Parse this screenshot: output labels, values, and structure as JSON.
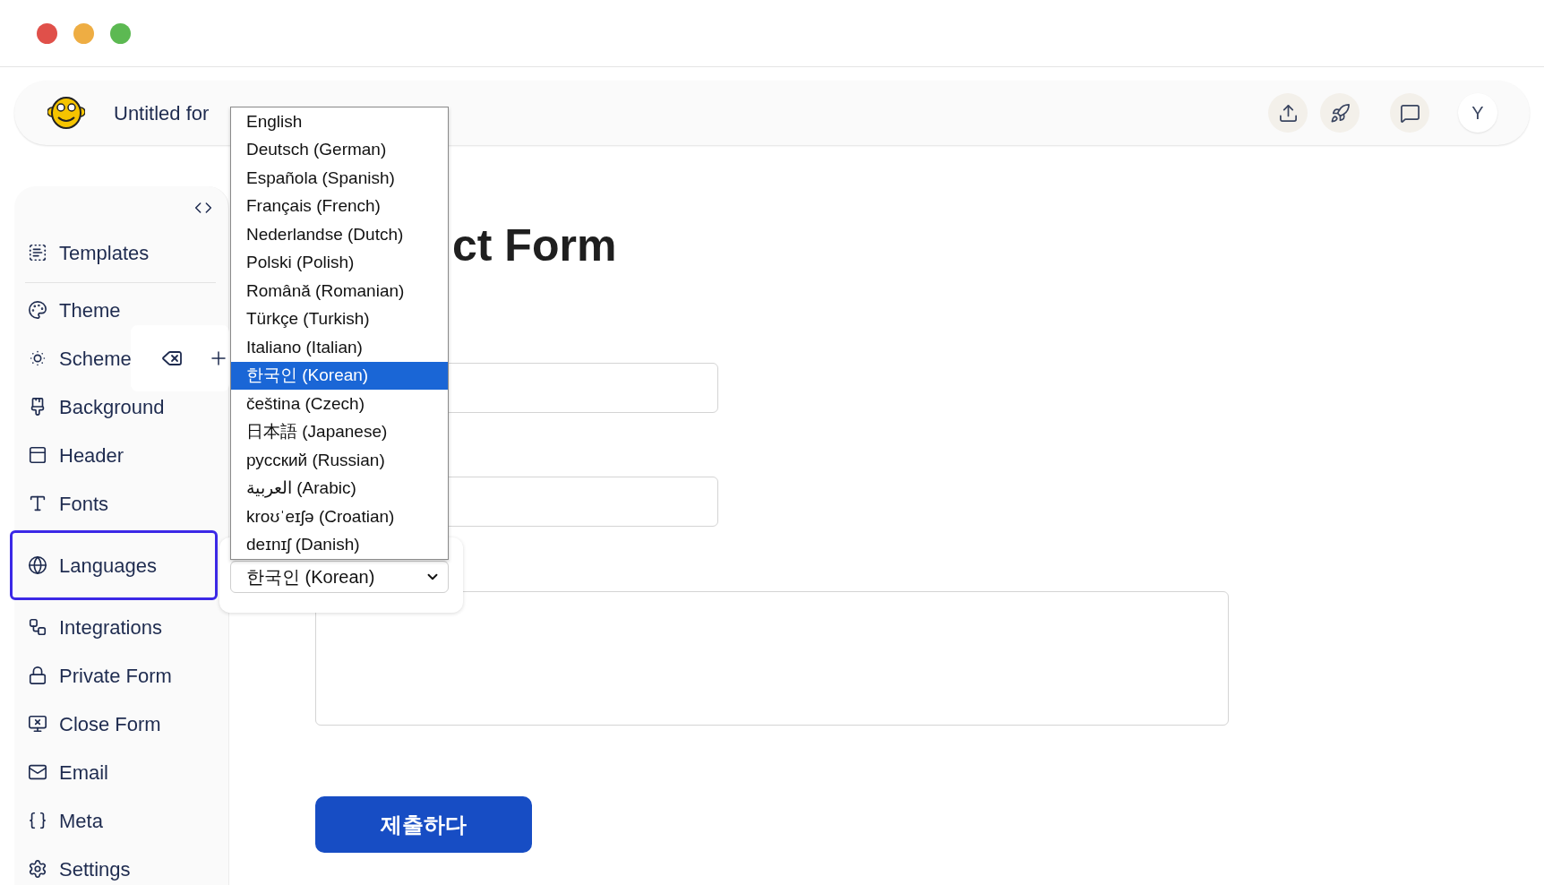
{
  "window": {
    "controls": [
      {
        "color": "#e0504a"
      },
      {
        "color": "#eead43"
      },
      {
        "color": "#5cb952"
      }
    ]
  },
  "header": {
    "title": "Untitled for",
    "actions": [
      {
        "kind": "upload"
      },
      {
        "kind": "rocket"
      },
      {
        "kind": "comment"
      },
      {
        "kind": "avatar",
        "label": "Y"
      }
    ]
  },
  "sidebar": {
    "sections": [
      {
        "items": [
          {
            "kind": "templates",
            "label": "Templates",
            "selected": false
          }
        ]
      },
      {
        "items": [
          {
            "kind": "theme",
            "label": "Theme",
            "selected": false
          },
          {
            "kind": "scheme",
            "label": "Scheme",
            "selected": false
          },
          {
            "kind": "background",
            "label": "Background",
            "selected": false
          },
          {
            "kind": "header",
            "label": "Header",
            "selected": false
          },
          {
            "kind": "fonts",
            "label": "Fonts",
            "selected": false
          },
          {
            "kind": "languages",
            "label": "Languages",
            "selected": true
          },
          {
            "kind": "integrations",
            "label": "Integrations",
            "selected": false
          },
          {
            "kind": "private",
            "label": "Private Form",
            "selected": false
          },
          {
            "kind": "close",
            "label": "Close Form",
            "selected": false
          },
          {
            "kind": "email",
            "label": "Email",
            "selected": false
          },
          {
            "kind": "meta",
            "label": "Meta",
            "selected": false
          },
          {
            "kind": "settings",
            "label": "Settings",
            "selected": false
          }
        ]
      }
    ]
  },
  "language_picker": {
    "value": "한국인 (Korean)",
    "expanded": true,
    "options": [
      {
        "label": "English",
        "selected": false
      },
      {
        "label": "Deutsch (German)",
        "selected": false
      },
      {
        "label": "Española (Spanish)",
        "selected": false
      },
      {
        "label": "Français (French)",
        "selected": false
      },
      {
        "label": "Nederlandse (Dutch)",
        "selected": false
      },
      {
        "label": "Polski (Polish)",
        "selected": false
      },
      {
        "label": "Română (Romanian)",
        "selected": false
      },
      {
        "label": "Türkçe (Turkish)",
        "selected": false
      },
      {
        "label": "Italiano (Italian)",
        "selected": false
      },
      {
        "label": "한국인 (Korean)",
        "selected": true
      },
      {
        "label": "čeština (Czech)",
        "selected": false
      },
      {
        "label": "日本語 (Japanese)",
        "selected": false
      },
      {
        "label": "русский (Russian)",
        "selected": false
      },
      {
        "label": "العربية (Arabic)",
        "selected": false
      },
      {
        "label": "kroʊˈeɪʃə (Croatian)",
        "selected": false
      },
      {
        "label": "deɪnɪʃ (Danish)",
        "selected": false
      }
    ]
  },
  "form": {
    "title": "ct Form",
    "fields": [
      {
        "kind": "input"
      },
      {
        "kind": "input"
      },
      {
        "kind": "textarea"
      }
    ],
    "submit": "제출하다"
  }
}
